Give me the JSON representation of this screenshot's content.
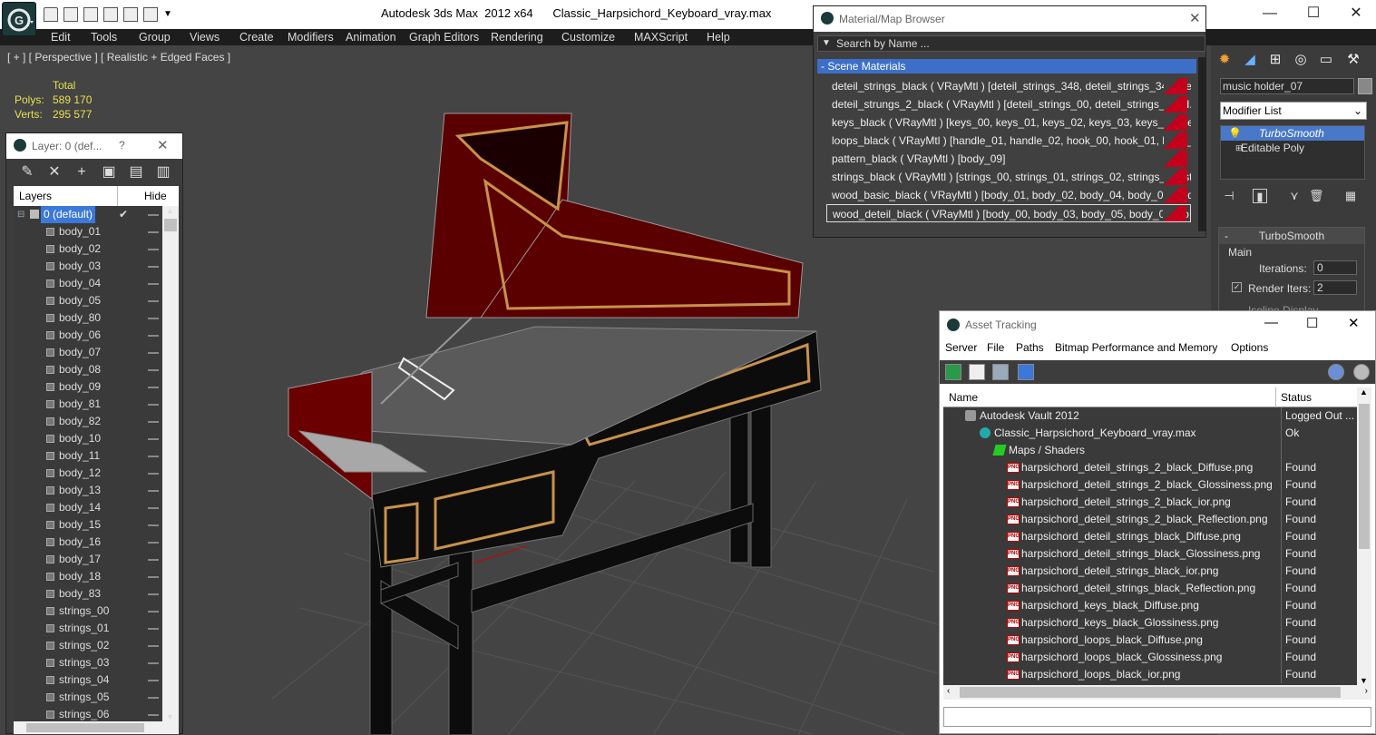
{
  "titlebar": {
    "app_title": "Autodesk 3ds Max  2012 x64",
    "file_title": "Classic_Harpsichord_Keyboard_vray.max",
    "minimize": "—",
    "maximize": "☐",
    "close": "✕"
  },
  "menu": [
    "Edit",
    "Tools",
    "Group",
    "Views",
    "Create",
    "Modifiers",
    "Animation",
    "Graph Editors",
    "Rendering",
    "Customize",
    "MAXScript",
    "Help"
  ],
  "viewport": {
    "label": "[ + ] [ Perspective ] [ Realistic + Edged Faces ]",
    "stats_header": "Total",
    "polys_label": "Polys:",
    "polys_value": "589 170",
    "verts_label": "Verts:",
    "verts_value": "295 577"
  },
  "layer_panel": {
    "title": "Layer: 0 (def...",
    "help": "?",
    "col_layers": "Layers",
    "col_hide": "Hide",
    "layers": [
      "0 (default)",
      "body_01",
      "body_02",
      "body_03",
      "body_04",
      "body_05",
      "body_80",
      "body_06",
      "body_07",
      "body_08",
      "body_09",
      "body_81",
      "body_82",
      "body_10",
      "body_11",
      "body_12",
      "body_13",
      "body_14",
      "body_15",
      "body_16",
      "body_17",
      "body_18",
      "body_83",
      "strings_00",
      "strings_01",
      "strings_02",
      "strings_03",
      "strings_04",
      "strings_05",
      "strings_06"
    ]
  },
  "material_browser": {
    "title": "Material/Map Browser",
    "search_placeholder": "Search by Name ...",
    "section": "Scene Materials",
    "materials": [
      "deteil_strings_black ( VRayMtl ) [deteil_strings_348, deteil_strings_349, de...",
      "deteil_strungs_2_black ( VRayMtl ) [deteil_strings_00, deteil_strings_01, d...",
      "keys_black ( VRayMtl ) [keys_00, keys_01, keys_02, keys_03, keys_04, ke...",
      "loops_black ( VRayMtl ) [handle_01, handle_02, hook_00, hook_01, hook_...",
      "pattern_black ( VRayMtl ) [body_09]",
      "strings_black ( VRayMtl ) [strings_00, strings_01, strings_02, strings_03, st...",
      "wood_basic_black ( VRayMtl ) [body_01, body_02, body_04, body_08, bod...",
      "wood_deteil_black ( VRayMtl ) [body_00, body_03, body_05, body_06, bo..."
    ]
  },
  "command_panel": {
    "object_name": "music holder_07",
    "modifier_list": "Modifier List",
    "stack": [
      "TurboSmooth",
      "Editable Poly"
    ],
    "rollout_title": "TurboSmooth",
    "group_main": "Main",
    "iterations_label": "Iterations:",
    "iterations_value": "0",
    "render_iters_label": "Render Iters:",
    "render_iters_value": "2",
    "isoline": "Isoline Display"
  },
  "asset_tracking": {
    "title": "Asset Tracking",
    "menu": [
      "Server",
      "File",
      "Paths",
      "Bitmap Performance and Memory",
      "Options"
    ],
    "col_name": "Name",
    "col_status": "Status",
    "rows": [
      {
        "name": "Autodesk Vault 2012",
        "status": "Logged Out ...",
        "level": 0,
        "kind": "vault"
      },
      {
        "name": "Classic_Harpsichord_Keyboard_vray.max",
        "status": "Ok",
        "level": 1,
        "kind": "max"
      },
      {
        "name": "Maps / Shaders",
        "status": "",
        "level": 2,
        "kind": "folder"
      },
      {
        "name": "harpsichord_deteil_strings_2_black_Diffuse.png",
        "status": "Found",
        "level": 3,
        "kind": "png"
      },
      {
        "name": "harpsichord_deteil_strings_2_black_Glossiness.png",
        "status": "Found",
        "level": 3,
        "kind": "png"
      },
      {
        "name": "harpsichord_deteil_strings_2_black_ior.png",
        "status": "Found",
        "level": 3,
        "kind": "png"
      },
      {
        "name": "harpsichord_deteil_strings_2_black_Reflection.png",
        "status": "Found",
        "level": 3,
        "kind": "png"
      },
      {
        "name": "harpsichord_deteil_strings_black_Diffuse.png",
        "status": "Found",
        "level": 3,
        "kind": "png"
      },
      {
        "name": "harpsichord_deteil_strings_black_Glossiness.png",
        "status": "Found",
        "level": 3,
        "kind": "png"
      },
      {
        "name": "harpsichord_deteil_strings_black_ior.png",
        "status": "Found",
        "level": 3,
        "kind": "png"
      },
      {
        "name": "harpsichord_deteil_strings_black_Reflection.png",
        "status": "Found",
        "level": 3,
        "kind": "png"
      },
      {
        "name": "harpsichord_keys_black_Diffuse.png",
        "status": "Found",
        "level": 3,
        "kind": "png"
      },
      {
        "name": "harpsichord_keys_black_Glossiness.png",
        "status": "Found",
        "level": 3,
        "kind": "png"
      },
      {
        "name": "harpsichord_loops_black_Diffuse.png",
        "status": "Found",
        "level": 3,
        "kind": "png"
      },
      {
        "name": "harpsichord_loops_black_Glossiness.png",
        "status": "Found",
        "level": 3,
        "kind": "png"
      },
      {
        "name": "harpsichord_loops_black_ior.png",
        "status": "Found",
        "level": 3,
        "kind": "png"
      }
    ]
  },
  "colors": {
    "accent": "#3c78d8",
    "material_swatch": "#c4001c",
    "stats_text": "#e8e050"
  }
}
